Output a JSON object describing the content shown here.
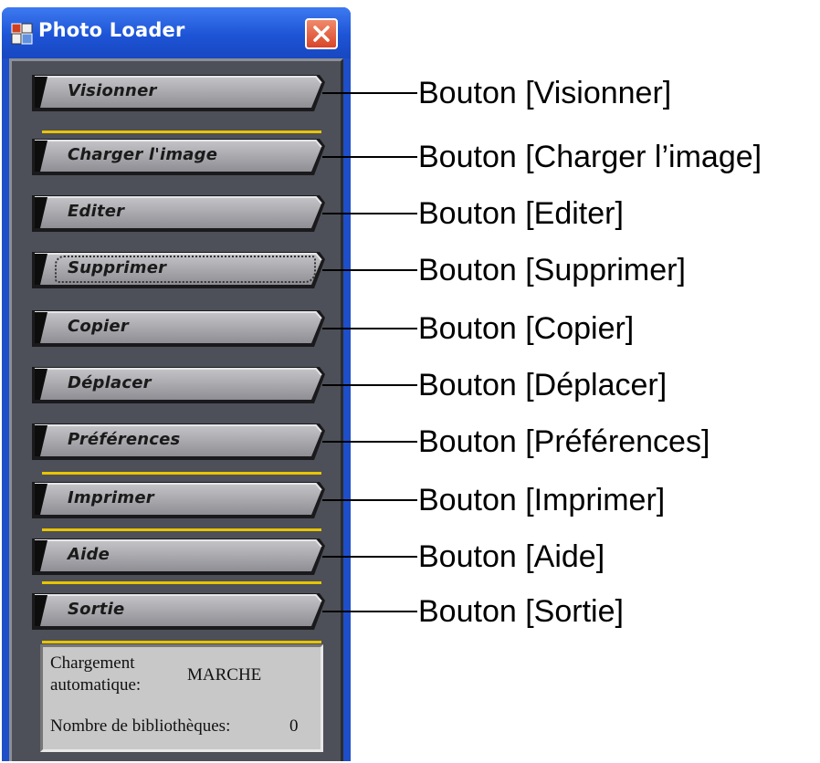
{
  "window": {
    "title": "Photo Loader",
    "app_icon": "app-window-icon",
    "close_icon": "close-icon"
  },
  "buttons": [
    {
      "label": "Visionner",
      "callout": "Bouton [Visionner]"
    },
    {
      "label": "Charger l'image",
      "callout": "Bouton [Charger l’image]"
    },
    {
      "label": "Editer",
      "callout": "Bouton [Editer]"
    },
    {
      "label": "Supprimer",
      "callout": "Bouton [Supprimer]",
      "focused": true
    },
    {
      "label": "Copier",
      "callout": "Bouton [Copier]"
    },
    {
      "label": "Déplacer",
      "callout": "Bouton [Déplacer]"
    },
    {
      "label": "Préférences",
      "callout": "Bouton [Préférences]"
    },
    {
      "label": "Imprimer",
      "callout": "Bouton [Imprimer]"
    },
    {
      "label": "Aide",
      "callout": "Bouton [Aide]"
    },
    {
      "label": "Sortie",
      "callout": "Bouton [Sortie]"
    }
  ],
  "status": {
    "auto_load_label_line1": "Chargement",
    "auto_load_label_line2": "automatique:",
    "auto_load_value": "MARCHE",
    "libraries_label": "Nombre de bibliothèques:",
    "libraries_value": "0"
  },
  "colors": {
    "separator": "#e8c400",
    "panel": "#4d5058",
    "button": "#a8a8ac",
    "titlebar": "#1d54d6"
  }
}
